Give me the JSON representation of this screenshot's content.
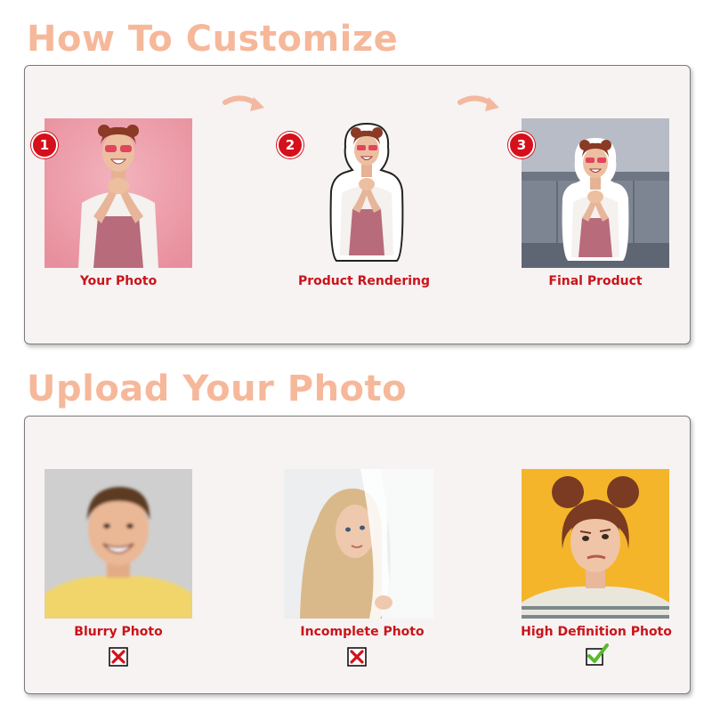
{
  "headings": {
    "how_to": "How To Customize",
    "upload": "Upload Your Photo"
  },
  "steps": [
    {
      "number": "1",
      "label": "Your Photo"
    },
    {
      "number": "2",
      "label": "Product Rendering"
    },
    {
      "number": "3",
      "label": "Final Product"
    }
  ],
  "examples": [
    {
      "label": "Blurry Photo",
      "status": "rejected",
      "icon": "x-icon"
    },
    {
      "label": "Incomplete Photo",
      "status": "rejected",
      "icon": "x-icon"
    },
    {
      "label": "High Definition Photo",
      "status": "accepted",
      "icon": "check-icon"
    }
  ],
  "colors": {
    "heading": "#f6b89a",
    "accent_red": "#c9141b",
    "check_green": "#5ab82e",
    "arrow": "#f4b8a0"
  }
}
